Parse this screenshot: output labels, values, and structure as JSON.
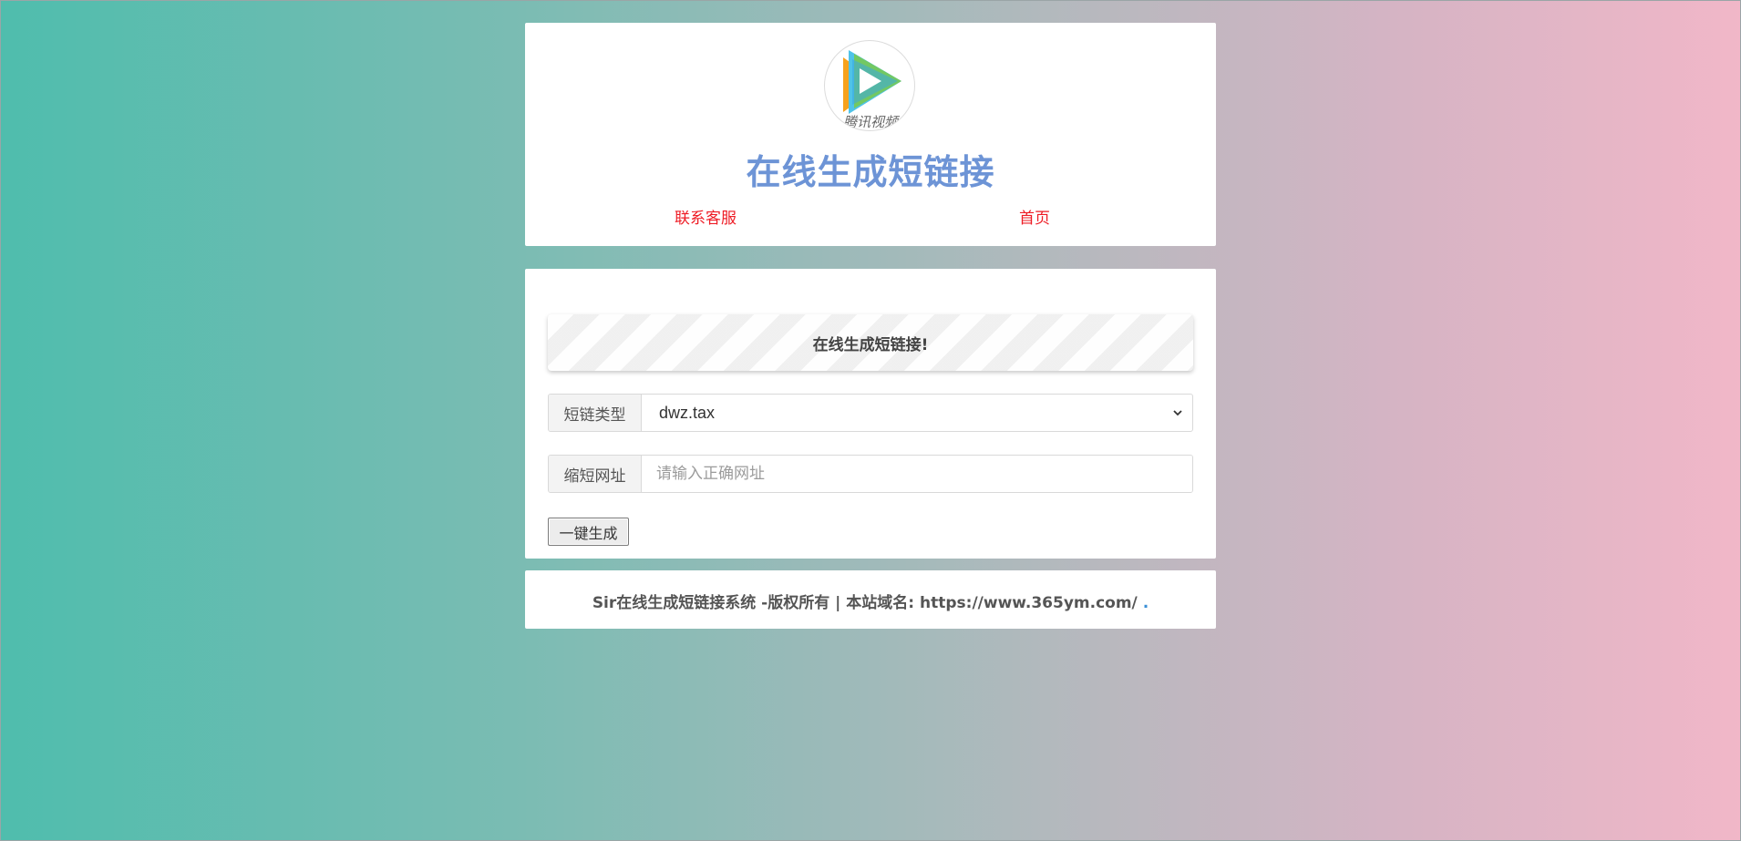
{
  "header": {
    "logo_icon": "tencent-video-logo",
    "logo_text": "腾讯视频",
    "title": "在线生成短链接",
    "nav": {
      "contact": "联系客服",
      "home": "首页"
    },
    "nav_color": "#ee1c25",
    "title_color": "#6d94d6"
  },
  "form": {
    "banner": "在线生成短链接!",
    "type_label": "短链类型",
    "type_value": "dwz.tax",
    "url_label": "缩短网址",
    "url_placeholder": "请输入正确网址",
    "url_value": "",
    "submit_label": "一键生成"
  },
  "footer": {
    "text": "Sir在线生成短链接系统 -版权所有 | 本站域名: https://www.365ym.com/",
    "dot": "."
  }
}
